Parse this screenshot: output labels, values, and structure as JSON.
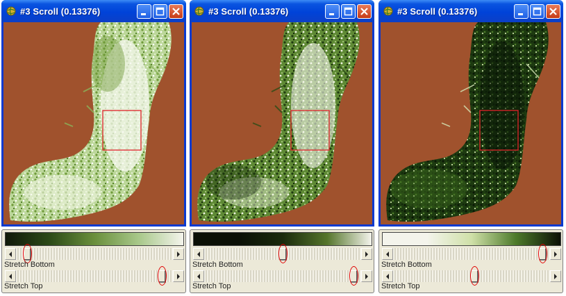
{
  "windows": [
    {
      "title": "#3 Scroll (0.13376)",
      "gradient": [
        "#10180a",
        "#2d4b18",
        "#6a8f3c",
        "#a8c88a",
        "#f4f4ec"
      ],
      "stretch_bottom": {
        "label": "Stretch Bottom",
        "value": 0.05
      },
      "stretch_top": {
        "label": "Stretch Top",
        "value": 0.95
      }
    },
    {
      "title": "#3 Scroll (0.13376)",
      "gradient": [
        "#0b1006",
        "#0b1006",
        "#1a2a0c",
        "#55752b",
        "#f4f4ec"
      ],
      "stretch_bottom": {
        "label": "Stretch Bottom",
        "value": 0.5
      },
      "stretch_top": {
        "label": "Stretch Top",
        "value": 0.97
      }
    },
    {
      "title": "#3 Scroll (0.13376)",
      "gradient": [
        "#f4f4ec",
        "#f4f4ec",
        "#cfe0a8",
        "#4d7a2a",
        "#0b1006"
      ],
      "stretch_bottom": {
        "label": "Stretch Bottom",
        "value": 0.97
      },
      "stretch_top": {
        "label": "Stretch Top",
        "value": 0.52
      }
    }
  ],
  "colors": {
    "title_bar": "#0043d8",
    "window_border": "#0a3ad0",
    "background": "#a0522d",
    "selection_box": "#e0242a",
    "annotation": "#e00000"
  },
  "icons": {
    "app": "globe-icon",
    "minimize": "minimize-icon",
    "maximize": "maximize-icon",
    "close": "close-icon",
    "scroll_left": "arrow-left-icon",
    "scroll_right": "arrow-right-icon"
  }
}
